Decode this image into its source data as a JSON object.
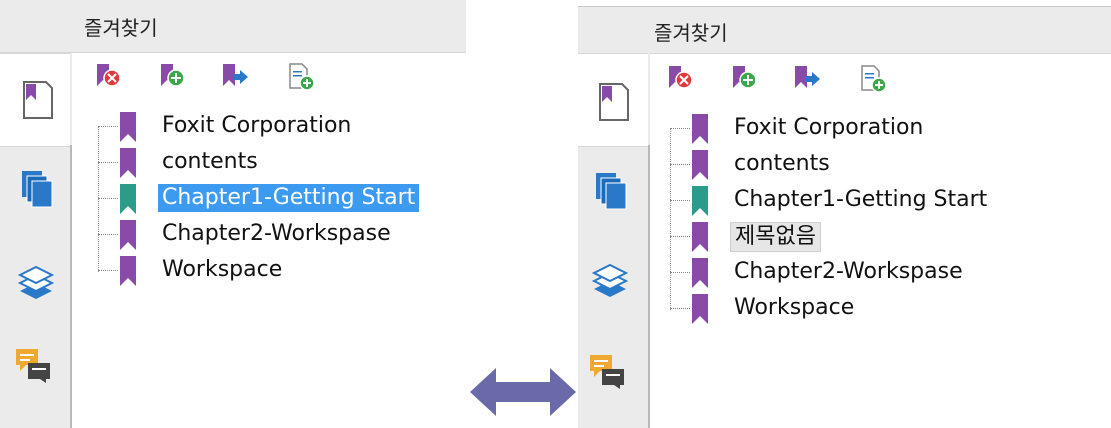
{
  "left_panel": {
    "header_title": "즐겨찾기",
    "bookmarks": [
      {
        "label": "Foxit Corporation",
        "color": "#8a4aa8",
        "state": "normal"
      },
      {
        "label": "contents",
        "color": "#8a4aa8",
        "state": "normal"
      },
      {
        "label": "Chapter1-Getting Start",
        "color": "#2b9b8a",
        "state": "selected"
      },
      {
        "label": "Chapter2-Workspase",
        "color": "#8a4aa8",
        "state": "normal"
      },
      {
        "label": "Workspace",
        "color": "#8a4aa8",
        "state": "normal"
      }
    ]
  },
  "right_panel": {
    "header_title": "즐겨찾기",
    "bookmarks": [
      {
        "label": "Foxit Corporation",
        "color": "#8a4aa8",
        "state": "normal"
      },
      {
        "label": "contents",
        "color": "#8a4aa8",
        "state": "normal"
      },
      {
        "label": "Chapter1-Getting Start",
        "color": "#2b9b8a",
        "state": "normal"
      },
      {
        "label": "제목없음",
        "color": "#8a4aa8",
        "state": "editing"
      },
      {
        "label": "Chapter2-Workspase",
        "color": "#8a4aa8",
        "state": "normal"
      },
      {
        "label": "Workspace",
        "color": "#8a4aa8",
        "state": "normal"
      }
    ]
  },
  "toolbar_icons": [
    "delete-bookmark-icon",
    "add-bookmark-icon",
    "move-bookmark-icon",
    "new-page-bookmark-icon"
  ],
  "side_icons": [
    "bookmarks-panel-icon",
    "pages-panel-icon",
    "layers-panel-icon",
    "comments-panel-icon"
  ],
  "colors": {
    "accent_selection": "#3c9bf0",
    "bookmark_purple": "#8a4aa8",
    "bookmark_teal": "#2b9b8a",
    "arrow": "#6a6aa8"
  }
}
